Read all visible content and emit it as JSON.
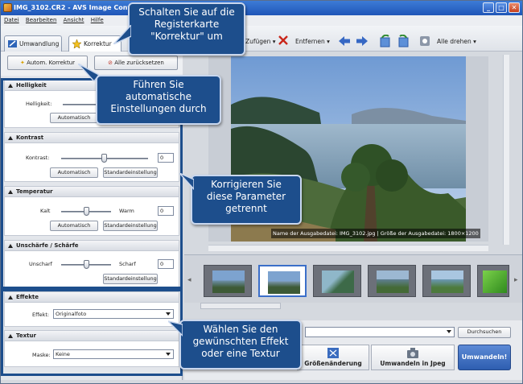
{
  "window": {
    "title": "IMG_3102.CR2 - AVS Image Converter",
    "minimize": "_",
    "maximize": "□",
    "close": "✕"
  },
  "menu": [
    "Datei",
    "Bearbeiten",
    "Ansicht",
    "Hilfe"
  ],
  "tabs": {
    "conversion": "Umwandlung",
    "correction": "Korrektur"
  },
  "toolbar": {
    "add": "Zufügen",
    "remove": "Entfernen",
    "rotate_all": "Alle drehen"
  },
  "left_buttons": {
    "auto_correct": "Autom. Korrektur",
    "reset_all": "Alle zurücksetzen"
  },
  "sections": {
    "brightness": {
      "title": "Helligkeit",
      "label": "Helligkeit:",
      "auto": "Automatisch"
    },
    "contrast": {
      "title": "Kontrast",
      "label": "Kontrast:",
      "value": "0",
      "auto": "Automatisch",
      "default": "Standardeinstellung"
    },
    "temperature": {
      "title": "Temperatur",
      "cold": "Kalt",
      "warm": "Warm",
      "value": "0",
      "auto": "Automatisch",
      "default": "Standardeinstellung"
    },
    "sharpness": {
      "title": "Unschärfe / Schärfe",
      "blur": "Unscharf",
      "sharp": "Scharf",
      "value": "0",
      "default": "Standardeinstellung"
    },
    "effects": {
      "title": "Effekte",
      "label": "Effekt:",
      "value": "Originalfoto"
    },
    "texture": {
      "title": "Textur",
      "label": "Maske:",
      "value": "Keine"
    }
  },
  "preview": {
    "status": "Name der Ausgabedatei: IMG_3102.jpg | Größe der Ausgabedatei: 1800×1200"
  },
  "bottom": {
    "browse": "Durchsuchen",
    "resize": "Größenänderung",
    "to_jpeg": "Umwandeln in Jpeg",
    "convert": "Umwandeln!"
  },
  "callouts": {
    "tab": "Schalten Sie auf die Registerkarte \"Korrektur\" um",
    "auto": "Führen Sie automatische Einstellungen durch",
    "params": "Korrigieren Sie diese Parameter getrennt",
    "effect": "Wählen Sie den gewünschten Effekt oder eine Textur"
  },
  "colors": {
    "callout_bg": "#1d4e8c",
    "titlebar": "#1f56b8"
  }
}
